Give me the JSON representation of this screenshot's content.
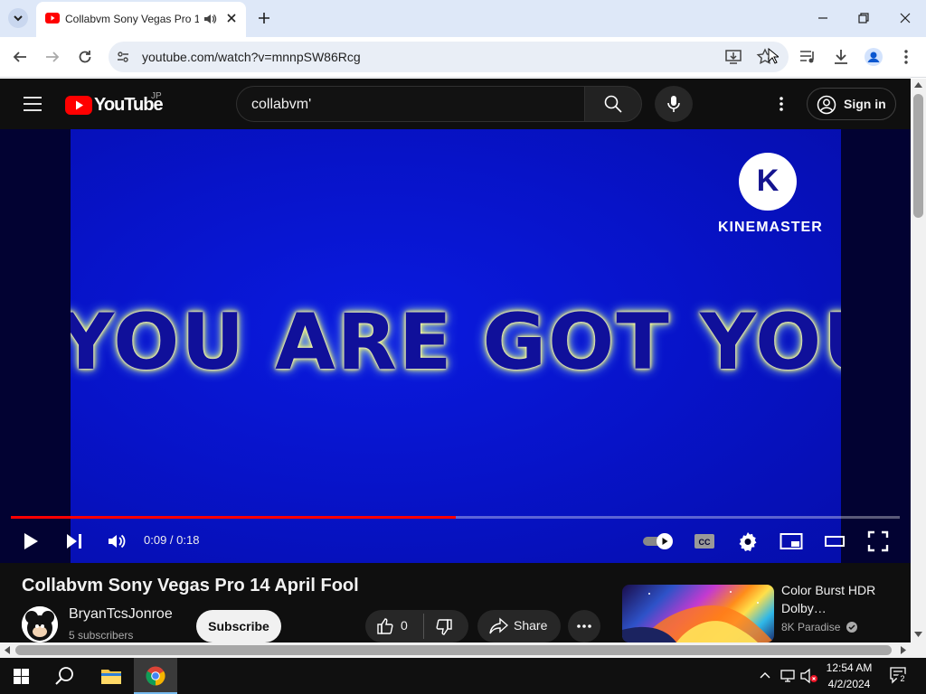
{
  "browser": {
    "tab_title": "Collabvm Sony Vegas Pro 1",
    "url": "youtube.com/watch?v=mnnpSW86Rcg"
  },
  "youtube": {
    "logo_text": "YouTube",
    "region": "JP",
    "search_query": "collabvm'",
    "sign_in_label": "Sign in"
  },
  "player": {
    "overlay_text": "YOU ARE GOT YOU",
    "watermark_letter": "K",
    "watermark_text": "KINEMASTER",
    "current_time": "0:09",
    "duration": "0:18",
    "time_display": "0:09 / 0:18",
    "progress_fraction": 0.5
  },
  "video": {
    "title": "Collabvm Sony Vegas Pro 14 April Fool",
    "channel": "BryanTcsJonroe",
    "subscribers": "5 subscribers",
    "subscribe_label": "Subscribe",
    "like_count": "0",
    "share_label": "Share"
  },
  "recommendation": {
    "title": "Color Burst HDR Dolby…",
    "channel": "8K Paradise"
  },
  "taskbar": {
    "time": "12:54 AM",
    "date": "4/2/2024",
    "notification_count": "2"
  },
  "colors": {
    "youtube_red": "#ff0000",
    "player_bg": "#020232",
    "video_blue": "#0713c8",
    "tabstrip": "#dee8f8",
    "taskbar": "#101010"
  }
}
